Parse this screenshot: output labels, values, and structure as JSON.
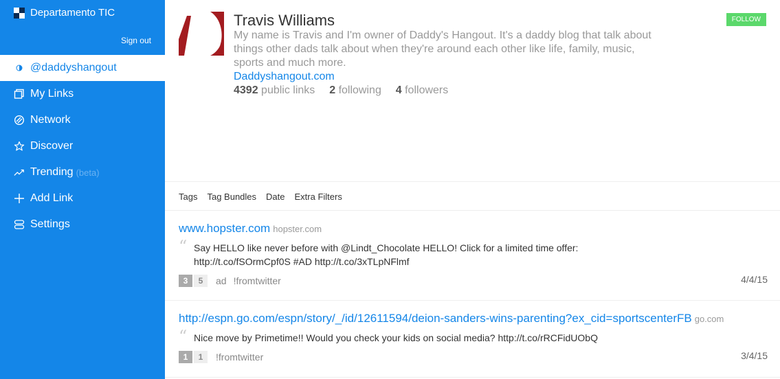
{
  "sidebar": {
    "brand": "Departamento TIC",
    "signout": "Sign out",
    "items": [
      {
        "label": "@daddyshangout",
        "icon": "half-circle-icon",
        "active": true
      },
      {
        "label": "My Links",
        "icon": "copy-icon"
      },
      {
        "label": "Network",
        "icon": "network-icon"
      },
      {
        "label": "Discover",
        "icon": "star-icon"
      },
      {
        "label": "Trending",
        "icon": "trending-icon",
        "extra": "(beta)"
      },
      {
        "label": "Add Link",
        "icon": "plus-icon"
      },
      {
        "label": "Settings",
        "icon": "settings-icon"
      }
    ]
  },
  "profile": {
    "name": "Travis Williams",
    "bio": "My name is Travis and I'm owner of Daddy's Hangout. It's a daddy blog that talk about things other dads talk about when they're around each other like life, family, music, sports and much more.",
    "website": "Daddyshangout.com",
    "stats": {
      "public_links": "4392",
      "public_links_label": "public links",
      "following": "2",
      "following_label": "following",
      "followers": "4",
      "followers_label": "followers"
    },
    "follow_label": "FOLLOW"
  },
  "filters": [
    "Tags",
    "Tag Bundles",
    "Date",
    "Extra Filters"
  ],
  "links": [
    {
      "title": "www.hopster.com",
      "domain": "hopster.com",
      "quote_line1": "Say HELLO like never before with @Lindt_Chocolate HELLO! Click for a limited time offer:",
      "quote_line2": "http://t.co/fSOrmCpf0S #AD http://t.co/3xTLpNFlmf",
      "count_a": "3",
      "count_b": "5",
      "tags": [
        "ad",
        "!fromtwitter"
      ],
      "date": "4/4/15"
    },
    {
      "title": "http://espn.go.com/espn/story/_/id/12611594/deion-sanders-wins-parenting?ex_cid=sportscenterFB",
      "domain": "go.com",
      "quote_line1": "Nice move by Primetime!! Would you check your kids on social media? http://t.co/rRCFidUObQ",
      "quote_line2": "",
      "count_a": "1",
      "count_b": "1",
      "tags": [
        "!fromtwitter"
      ],
      "date": "3/4/15"
    }
  ],
  "colors": {
    "accent": "#1486e8",
    "follow": "#5bd86b",
    "avatar": "#a31c20"
  }
}
